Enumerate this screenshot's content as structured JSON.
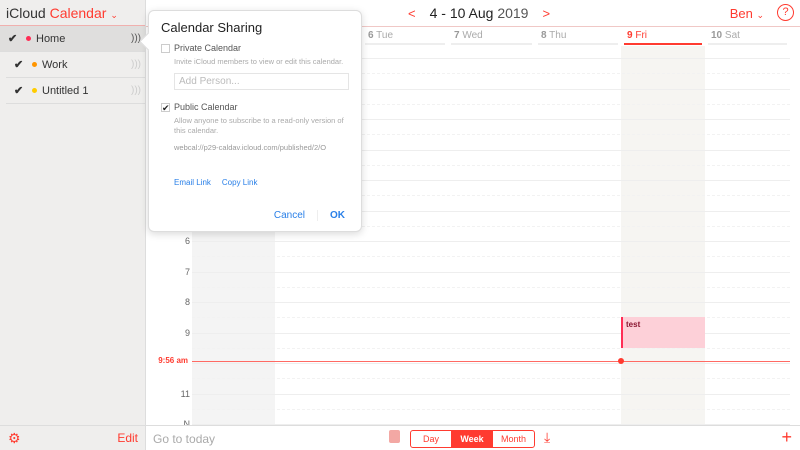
{
  "brand": {
    "name": "iCloud",
    "app": "Calendar"
  },
  "calendars": [
    {
      "label": "Home",
      "color": "#ff2d55",
      "checked": true,
      "selected": true
    },
    {
      "label": "Work",
      "color": "#ff9500",
      "checked": true
    },
    {
      "label": "Untitled 1",
      "color": "#ffcc00",
      "checked": true
    }
  ],
  "sidebar_footer": {
    "edit": "Edit"
  },
  "header": {
    "range": "4 - 10 Aug",
    "year": "2019",
    "user": "Ben",
    "help": "?"
  },
  "days": [
    {
      "num": "6",
      "name": "Tue"
    },
    {
      "num": "7",
      "name": "Wed"
    },
    {
      "num": "8",
      "name": "Thu"
    },
    {
      "num": "9",
      "name": "Fri",
      "today": true
    },
    {
      "num": "10",
      "name": "Sat"
    }
  ],
  "hours": [
    "6",
    "7",
    "8",
    "9",
    "11",
    "N"
  ],
  "now": {
    "label": "9:56 am",
    "hour": 9.93
  },
  "events": [
    {
      "title": "test",
      "day": "9 Fri",
      "start": 8.5,
      "end": 9.5
    }
  ],
  "footer": {
    "goto": "Go to today",
    "views": [
      "Day",
      "Week",
      "Month"
    ],
    "active": "Week"
  },
  "popover": {
    "title": "Calendar Sharing",
    "private_label": "Private Calendar",
    "private_desc": "Invite iCloud members to view or edit this calendar.",
    "add_placeholder": "Add Person...",
    "public_label": "Public Calendar",
    "public_checked": true,
    "public_desc": "Allow anyone to subscribe to a read-only version of this calendar.",
    "url": "webcal://p29-caldav.icloud.com/published/2/O",
    "email_link": "Email Link",
    "copy_link": "Copy Link",
    "cancel": "Cancel",
    "ok": "OK"
  }
}
